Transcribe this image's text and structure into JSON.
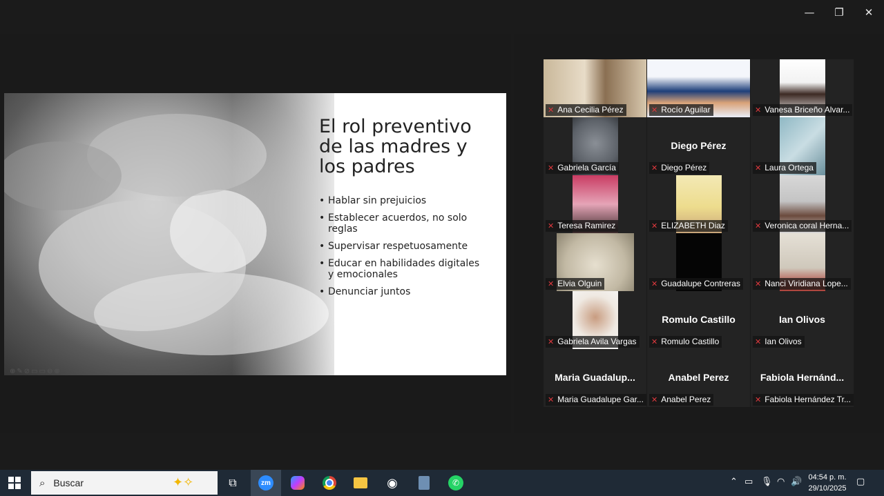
{
  "window": {
    "minimize": "—",
    "restore": "❐",
    "close": "✕"
  },
  "slide": {
    "title": "El rol preventivo de las madres y los padres",
    "bullets": [
      "Hablar sin prejuicios",
      "Establecer acuerdos, no solo reglas",
      "Supervisar respetuosamente",
      "Educar en habilidades digitales y emocionales",
      "Denunciar juntos"
    ]
  },
  "participants": [
    {
      "name": "Ana Cecilia Pérez",
      "video": true,
      "active": true
    },
    {
      "name": "Rocío Aguilar",
      "video": true
    },
    {
      "name": "Vanesa Briceño Alvar...",
      "video": true
    },
    {
      "name": "Gabriela García",
      "video": true
    },
    {
      "name": "Diego Pérez",
      "display": "Diego Pérez",
      "video": false
    },
    {
      "name": "Laura Ortega",
      "video": true
    },
    {
      "name": "Teresa Ramirez",
      "video": true
    },
    {
      "name": "ELIZABETH Diaz",
      "video": true
    },
    {
      "name": "Veronica coral Herna...",
      "video": true
    },
    {
      "name": "Elvia Olguin",
      "video": true
    },
    {
      "name": "Guadalupe Contreras",
      "video": true
    },
    {
      "name": "Nanci Viridiana Lope...",
      "video": true
    },
    {
      "name": "Gabriela Avila Vargas",
      "video": true
    },
    {
      "name": "Romulo Castillo",
      "display": "Romulo Castillo",
      "video": false
    },
    {
      "name": "Ian Olivos",
      "display": "Ian Olivos",
      "video": false
    },
    {
      "name": "Maria Guadalupe Gar...",
      "display": "Maria  Guadalup...",
      "video": false
    },
    {
      "name": "Anabel Perez",
      "display": "Anabel Perez",
      "video": false
    },
    {
      "name": "Fabiola Hernández Tr...",
      "display": "Fabiola  Hernánd...",
      "video": false
    }
  ],
  "taskbar": {
    "search_placeholder": "Buscar",
    "zoom_label": "zm",
    "time": "04:54 p. m.",
    "date": "29/10/2025"
  }
}
